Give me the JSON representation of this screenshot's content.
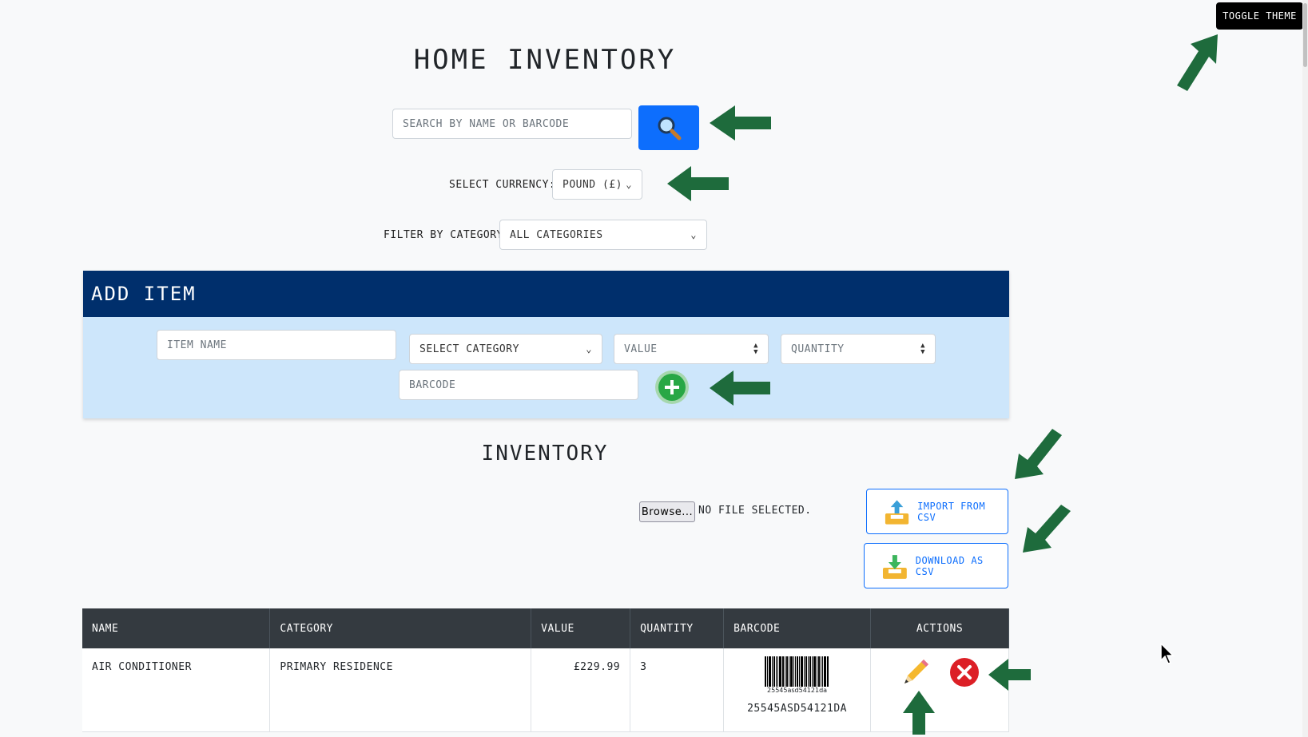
{
  "header": {
    "title": "HOME INVENTORY",
    "toggle_label": "TOGGLE THEME"
  },
  "search": {
    "placeholder": "SEARCH BY NAME OR BARCODE"
  },
  "currency": {
    "label": "SELECT CURRENCY:",
    "selected": "POUND (£)"
  },
  "category_filter": {
    "label": "FILTER BY CATEGORY:",
    "selected": "ALL CATEGORIES"
  },
  "add_item": {
    "heading": "ADD ITEM",
    "item_name_placeholder": "ITEM NAME",
    "category_selected": "SELECT CATEGORY",
    "value_placeholder": "VALUE",
    "quantity_placeholder": "QUANTITY",
    "barcode_placeholder": "BARCODE"
  },
  "inventory": {
    "heading": "INVENTORY",
    "browse_label": "Browse...",
    "file_status": "NO FILE SELECTED.",
    "import_label": "IMPORT FROM CSV",
    "download_label": "DOWNLOAD AS CSV",
    "columns": [
      "NAME",
      "CATEGORY",
      "VALUE",
      "QUANTITY",
      "BARCODE",
      "ACTIONS"
    ],
    "rows": [
      {
        "name": "AIR CONDITIONER",
        "category": "PRIMARY RESIDENCE",
        "value": "£229.99",
        "quantity": "3",
        "barcode_image_text": "25545asd54121da",
        "barcode": "25545ASD54121DA"
      }
    ]
  },
  "colors": {
    "primary": "#0d6efd",
    "header_navy": "#002f6c",
    "panel_blue": "#cde6fb",
    "success": "#28a745",
    "danger": "#dc3545",
    "arrow_green": "#1e6b3c",
    "table_head": "#343a40"
  }
}
